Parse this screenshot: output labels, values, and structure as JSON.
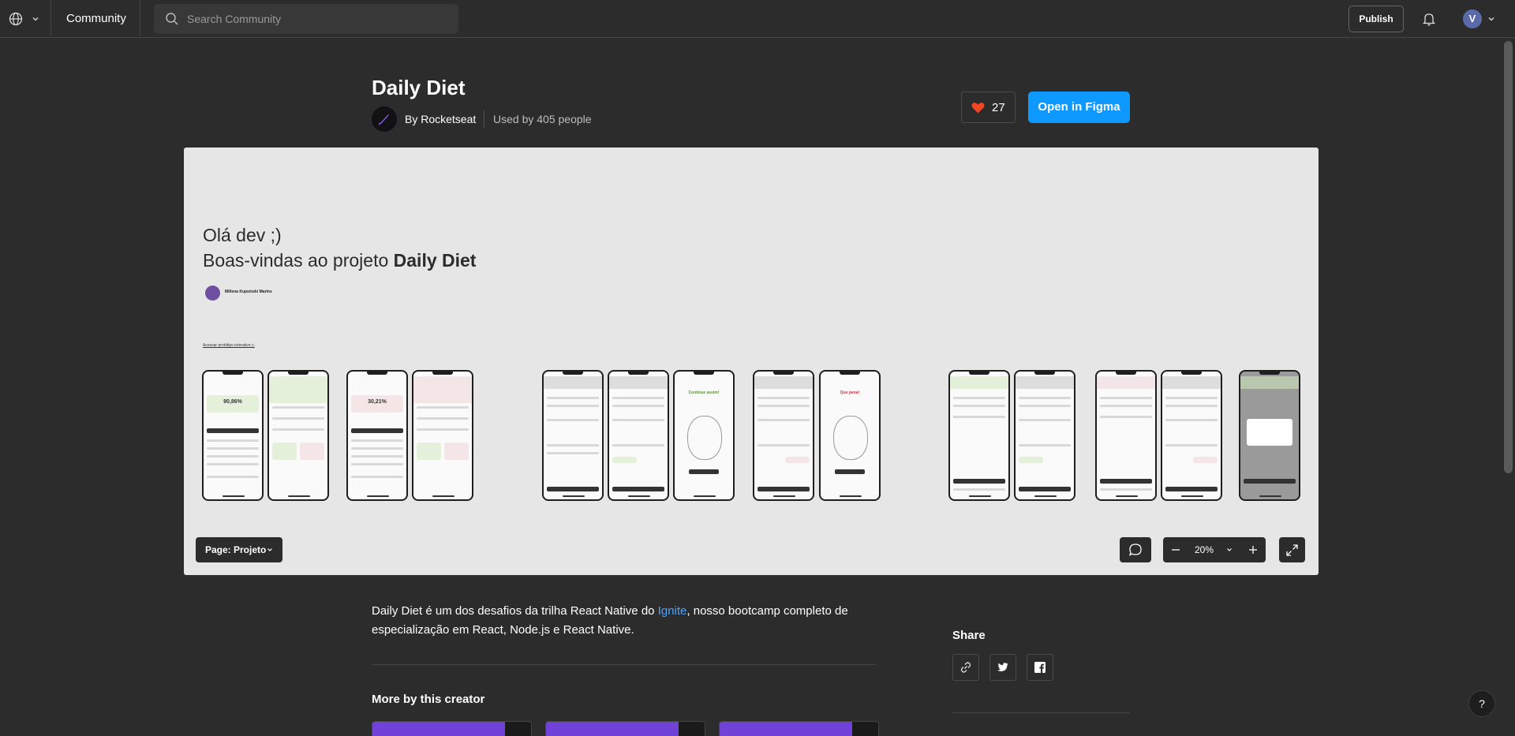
{
  "nav": {
    "community_label": "Community",
    "search_placeholder": "Search Community",
    "publish_label": "Publish",
    "avatar_initial": "V"
  },
  "file": {
    "title": "Daily Diet",
    "creator": "By Rocketseat",
    "used_by": "Used by 405 people",
    "likes": "27",
    "open_label": "Open in Figma"
  },
  "preview": {
    "greeting": "Olá dev ;)",
    "welcome_prefix": "Boas-vindas ao projeto ",
    "welcome_bold": "Daily Diet",
    "author_name": "Millena Kupsinski Marins",
    "prototype_link": "Acessar protótipo interativo ▷",
    "page_selector": "Page: Projeto",
    "zoom": "20%",
    "phone_texts": {
      "pct1": "90,86%",
      "pct2": "30,21%",
      "continue": "Continue assim!",
      "shame": "Que pena!"
    }
  },
  "description": {
    "text_before": "Daily Diet é um dos desafios da trilha React Native do ",
    "link": "Ignite",
    "text_after": ", nosso bootcamp completo de especialização em React, Node.js e React Native."
  },
  "more": {
    "title": "More by this creator"
  },
  "share": {
    "title": "Share",
    "items": [
      "link-icon",
      "twitter-icon",
      "facebook-icon"
    ]
  },
  "help_label": "?",
  "colors": {
    "accent": "#0d99ff",
    "background": "#2c2c2c",
    "heart": "#f24822",
    "card": "#7042d8",
    "link": "#4da3ff"
  }
}
